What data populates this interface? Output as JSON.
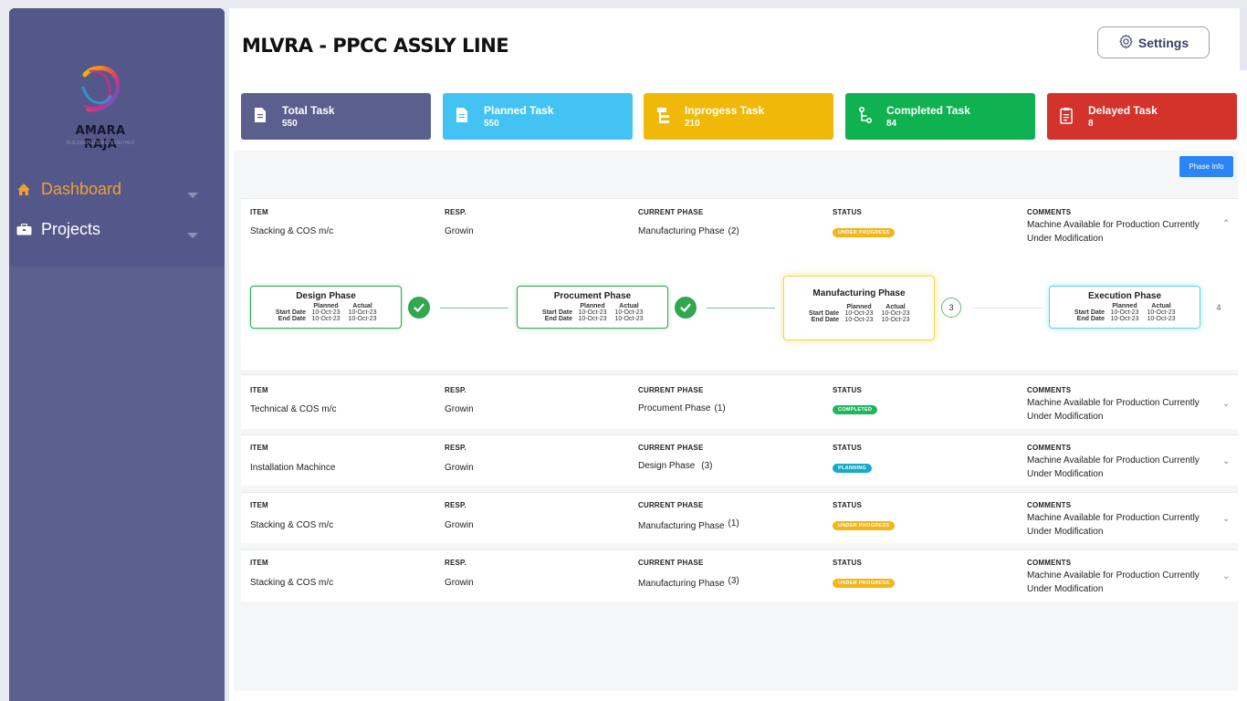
{
  "app": {
    "brand": "AMARA RAJA",
    "brand_tagline": "BUILDING FUTURE TOGETHER",
    "page_title": "MLVRA - PPCC ASSLY LINE",
    "settings_label": "Settings",
    "phase_info_label": "Phase Info"
  },
  "sidebar": {
    "items": [
      {
        "label": "Dashboard",
        "icon": "home-icon",
        "active": true
      },
      {
        "label": "Projects",
        "icon": "briefcase-icon",
        "active": false
      }
    ]
  },
  "stats": [
    {
      "label": "Total Task",
      "value": "550",
      "color": "#5b5f8e",
      "icon": "document-icon"
    },
    {
      "label": "Planned Task",
      "value": "550",
      "color": "#43c3f3",
      "icon": "document-icon"
    },
    {
      "label": "Inprogess Task",
      "value": "210",
      "color": "#f0b808",
      "icon": "hierarchy-icon"
    },
    {
      "label": "Completed Task",
      "value": "84",
      "color": "#10b150",
      "icon": "branch-icon"
    },
    {
      "label": "Delayed Task",
      "value": "8",
      "color": "#d3332a",
      "icon": "clipboard-icon"
    }
  ],
  "columns": {
    "item": "ITEM",
    "resp": "RESP.",
    "phase": "CURRENT PHASE",
    "status": "STATUS",
    "comments": "COMMENTS"
  },
  "rows": [
    {
      "item": "Stacking & COS m/c",
      "resp": "Growin",
      "phase": "Manufacturing Phase",
      "phase_num": "(2)",
      "status": "UNDER PROGRESS",
      "comment": "Machine Available for Production Currently Under Modification",
      "expanded": true
    },
    {
      "item": "Technical & COS m/c",
      "resp": "Growin",
      "phase": "Procument Phase",
      "phase_num": "(1)",
      "status": "COMPLETED",
      "comment": "Machine Available for Production Currently Under Modification"
    },
    {
      "item": "Installation Machince",
      "resp": "Growin",
      "phase": "Design Phase",
      "phase_num": "(3)",
      "status": "PLANNING",
      "comment": "Machine Available for Production Currently Under Modification"
    },
    {
      "item": "Stacking & COS m/c",
      "resp": "Growin",
      "phase": "Manufacturing Phase",
      "phase_num": "(1)",
      "status": "UNDER PROGRESS",
      "comment": "Machine Available for Production Currently Under Modification"
    },
    {
      "item": "Stacking & COS m/c",
      "resp": "Growin",
      "phase": "Manufacturing Phase",
      "phase_num": "(3)",
      "status": "UNDER PROGRESS",
      "comment": "Machine Available for Production Currently Under Modification"
    }
  ],
  "timeline": {
    "labels": {
      "planned": "Planned",
      "actual": "Actual",
      "start": "Start Date",
      "end": "End Date"
    },
    "phases": [
      {
        "title": "Design Phase",
        "start_planned": "10-Oct-23",
        "start_actual": "10-Oct-23",
        "end_planned": "10-Oct-23",
        "end_actual": "10-Oct-23",
        "state": "done"
      },
      {
        "title": "Procument Phase",
        "start_planned": "10-Oct-23",
        "start_actual": "10-Oct-23",
        "end_planned": "10-Oct-23",
        "end_actual": "10-Oct-23",
        "state": "done"
      },
      {
        "title": "Manufacturing Phase",
        "start_planned": "10-Oct-23",
        "start_actual": "10-Oct-23",
        "end_planned": "10-Oct-23",
        "end_actual": "10-Oct-23",
        "state": "current",
        "step": "3"
      },
      {
        "title": "Execution Phase",
        "start_planned": "10-Oct-23",
        "start_actual": "10-Oct-23",
        "end_planned": "10-Oct-23",
        "end_actual": "10-Oct-23",
        "state": "pending",
        "step": "4"
      }
    ]
  }
}
